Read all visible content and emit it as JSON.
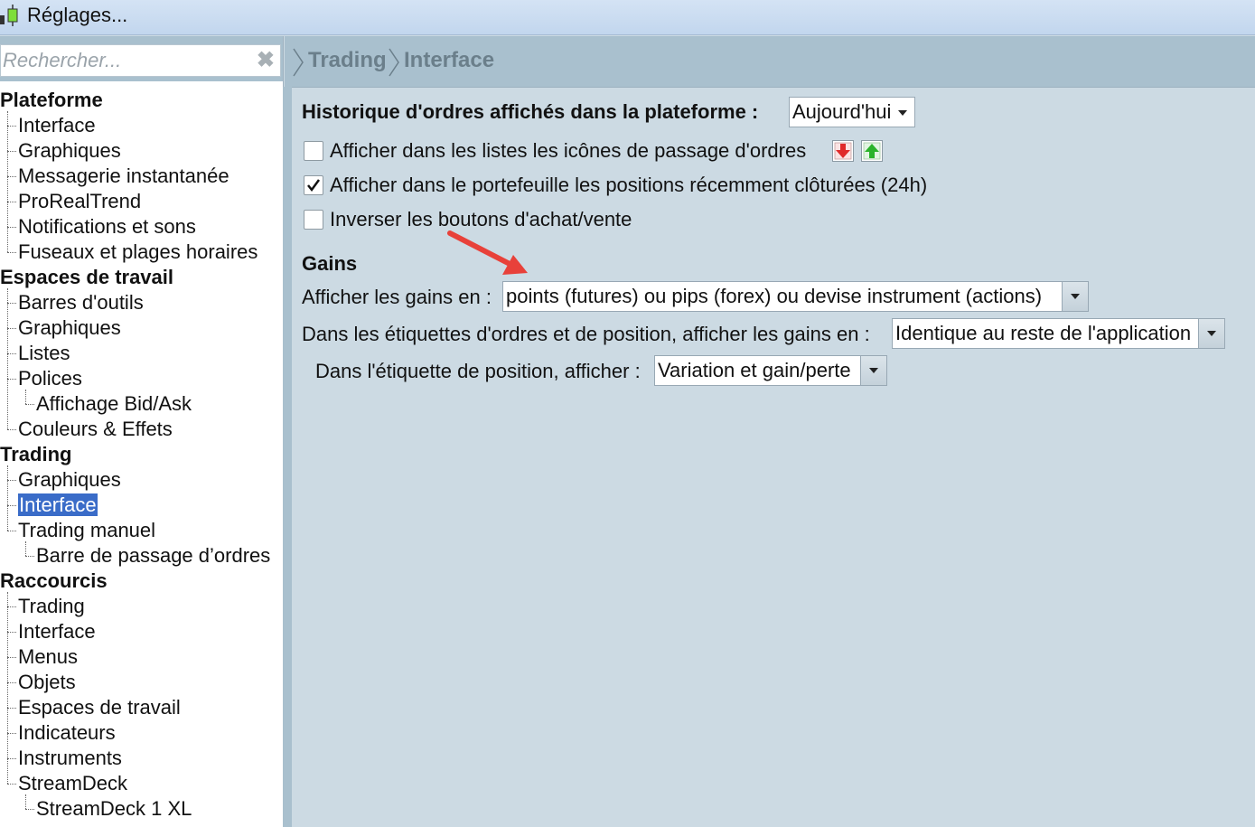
{
  "window": {
    "title": "Réglages..."
  },
  "search": {
    "placeholder": "Rechercher..."
  },
  "breadcrumb": [
    "Trading",
    "Interface"
  ],
  "tree": [
    {
      "label": "Plateforme",
      "level": 0
    },
    {
      "label": "Interface",
      "level": 1
    },
    {
      "label": "Graphiques",
      "level": 1
    },
    {
      "label": "Messagerie instantanée",
      "level": 1
    },
    {
      "label": "ProRealTrend",
      "level": 1
    },
    {
      "label": "Notifications et sons",
      "level": 1
    },
    {
      "label": "Fuseaux et plages horaires",
      "level": 1
    },
    {
      "label": "Espaces de travail",
      "level": 0
    },
    {
      "label": "Barres d'outils",
      "level": 1
    },
    {
      "label": "Graphiques",
      "level": 1
    },
    {
      "label": "Listes",
      "level": 1
    },
    {
      "label": "Polices",
      "level": 1
    },
    {
      "label": "Affichage Bid/Ask",
      "level": 2
    },
    {
      "label": "Couleurs & Effets",
      "level": 1
    },
    {
      "label": "Trading",
      "level": 0
    },
    {
      "label": "Graphiques",
      "level": 1
    },
    {
      "label": "Interface",
      "level": 1,
      "selected": true
    },
    {
      "label": "Trading manuel",
      "level": 1
    },
    {
      "label": "Barre de passage d’ordres",
      "level": 2
    },
    {
      "label": "Raccourcis",
      "level": 0
    },
    {
      "label": "Trading",
      "level": 1
    },
    {
      "label": "Interface",
      "level": 1
    },
    {
      "label": "Menus",
      "level": 1
    },
    {
      "label": "Objets",
      "level": 1
    },
    {
      "label": "Espaces de travail",
      "level": 1
    },
    {
      "label": "Indicateurs",
      "level": 1
    },
    {
      "label": "Instruments",
      "level": 1
    },
    {
      "label": "StreamDeck",
      "level": 1
    },
    {
      "label": "StreamDeck 1 XL",
      "level": 2
    }
  ],
  "settings": {
    "order_history_label": "Historique d'ordres affichés dans la plateforme :",
    "order_history_value": "Aujourd'hui",
    "show_order_icons_label": "Afficher dans les listes les icônes de passage d'ordres",
    "show_order_icons_checked": false,
    "show_closed_positions_label": "Afficher dans le portefeuille les positions récemment clôturées (24h)",
    "show_closed_positions_checked": true,
    "invert_buttons_label": "Inverser les boutons d'achat/vente",
    "invert_buttons_checked": false,
    "gains_heading": "Gains",
    "gains_unit_label": "Afficher les gains en :",
    "gains_unit_value": "points (futures) ou pips (forex) ou devise instrument (actions)",
    "label_gains_label": "Dans les étiquettes d'ordres et de position, afficher les gains en :",
    "label_gains_value": "Identique au reste de l'application",
    "position_label_label": "Dans l'étiquette de position, afficher :",
    "position_label_value": "Variation et gain/perte"
  },
  "colors": {
    "selection": "#3a6cc8",
    "background": "#ccdae3",
    "header": "#a9c0ce",
    "annotation_arrow": "#e8413a",
    "sell_icon": "#e02a2a",
    "buy_icon": "#2bb32b"
  }
}
